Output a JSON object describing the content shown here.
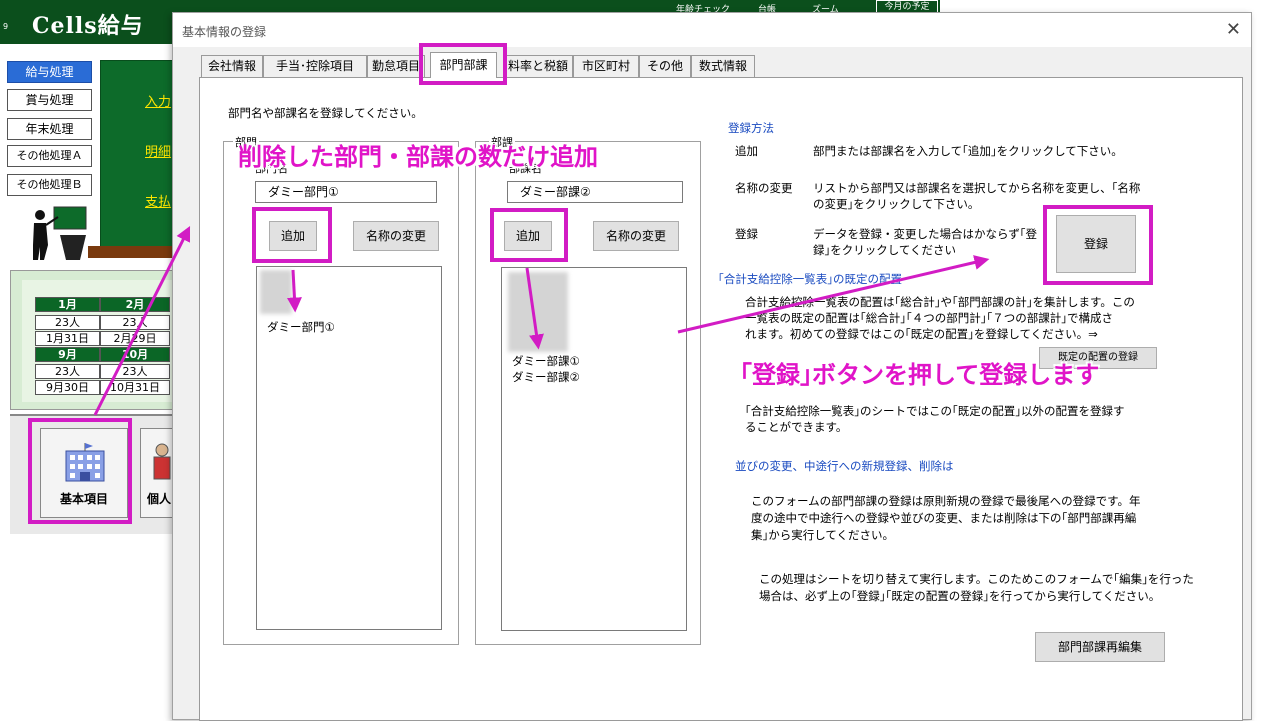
{
  "app": {
    "title": "Cells給与",
    "row_number": "9",
    "header_minis": [
      "年齢チェック",
      "台帳",
      "ズーム"
    ],
    "month_plan": "今月の予定",
    "side_menu": [
      {
        "label": "給与処理",
        "active": true
      },
      {
        "label": "賞与処理",
        "active": false
      },
      {
        "label": "年末処理",
        "active": false
      },
      {
        "label": "その他処理Ａ",
        "active": false
      },
      {
        "label": "その他処理Ｂ",
        "active": false
      }
    ],
    "green_links": [
      "入力",
      "明細",
      "支払"
    ],
    "calendar": {
      "row1_heads": [
        "1月",
        "2月"
      ],
      "row1_counts": [
        "23人",
        "23人"
      ],
      "row1_dates": [
        "1月31日",
        "2月29日"
      ],
      "row2_heads": [
        "9月",
        "10月"
      ],
      "row2_counts": [
        "23人",
        "23人"
      ],
      "row2_dates": [
        "9月30日",
        "10月31日"
      ]
    },
    "icon_buttons": {
      "kihon": "基本項目",
      "kojin": "個人"
    }
  },
  "dialog": {
    "title": "基本情報の登録",
    "close_glyph": "✕",
    "tabs": [
      {
        "label": "会社情報"
      },
      {
        "label": "手当･控除項目"
      },
      {
        "label": "勤怠項目"
      },
      {
        "label": "部門部課",
        "active": true
      },
      {
        "label": "料率と税額"
      },
      {
        "label": "市区町村"
      },
      {
        "label": "その他"
      },
      {
        "label": "数式情報"
      }
    ],
    "intro": "部門名や部課名を登録してください。",
    "bumon": {
      "frame_label": "部門",
      "field_label": "部門名",
      "input_value": "ダミー部門①",
      "add_button": "追加",
      "rename_button": "名称の変更",
      "items": [
        "ダミー部門①"
      ]
    },
    "buka": {
      "frame_label": "部課",
      "field_label": "部課名",
      "input_value": "ダミー部課②",
      "add_button": "追加",
      "rename_button": "名称の変更",
      "items": [
        "ダミー部課①",
        "ダミー部課②"
      ]
    },
    "method": {
      "heading": "登録方法",
      "rows": [
        {
          "term": "追加",
          "desc1": "部門または部課名を入力して｢追加｣をクリックして下さい。",
          "desc2": ""
        },
        {
          "term": "名称の変更",
          "desc1": "リストから部門又は部課名を選択してから名称を変更し、｢名称",
          "desc2": "の変更｣をクリックして下さい。"
        },
        {
          "term": "登録",
          "desc1": "データを登録・変更した場合はかならず｢登",
          "desc2": "録｣をクリックしてください"
        }
      ],
      "register_button": "登録"
    },
    "kitei": {
      "heading": "｢合計支給控除一覧表｣の既定の配置",
      "lines": [
        "合計支給控除一覧表の配置は｢総合計｣や｢部門部課の計｣を集計します。この",
        "一覧表の既定の配置は｢総合計｣｢４つの部門計｣｢７つの部課計｣で構成さ",
        "れます。初めての登録ではこの｢既定の配置｣を登録してください。⇒"
      ],
      "button": "既定の配置の登録",
      "note1": "｢合計支給控除一覧表｣のシートではこの｢既定の配置｣以外の配置を登録す",
      "note2": "ることができます。"
    },
    "order": {
      "heading": "並びの変更、中途行への新規登録、削除は",
      "p1": [
        "このフォームの部門部課の登録は原則新規の登録で最後尾への登録です。年",
        "度の途中で中途行への登録や並びの変更、または削除は下の｢部門部課再編",
        "集｣から実行してください。"
      ],
      "p2": [
        "この処理はシートを切り替えて実行します。このためこのフォームで｢編集｣を行った",
        "場合は、必ず上の｢登録｣｢既定の配置の登録｣を行ってから実行してください。"
      ],
      "reedit_button": "部門部課再編集"
    }
  },
  "annotations": {
    "callout_add": "削除した部門・部課の数だけ追加",
    "callout_register": "｢登録｣ボタンを押して登録します",
    "highlight_color": "#d21cc4"
  }
}
